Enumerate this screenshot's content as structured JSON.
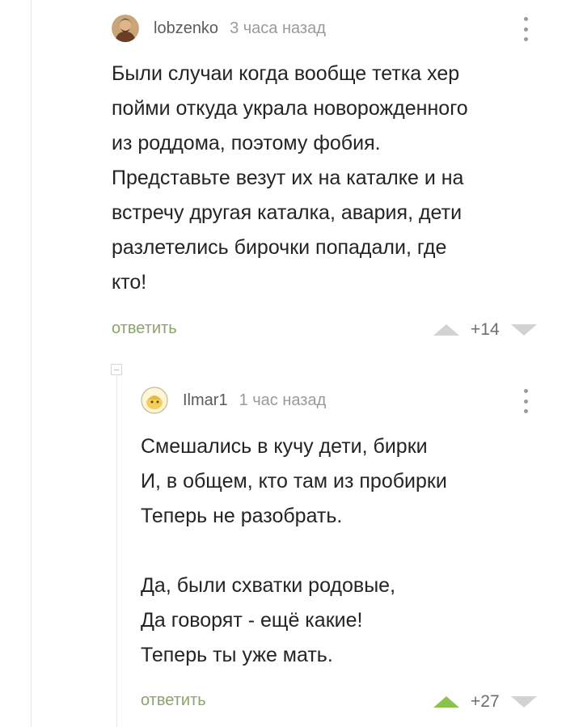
{
  "colors": {
    "reply_link": "#8aa46b",
    "upvote_active": "#8bc34a",
    "vote_inactive": "#d2d2d2",
    "thread_line": "#e6e6e6"
  },
  "comments": [
    {
      "author": "lobzenko",
      "time": "3 часа назад",
      "avatar_icon": "avatar-portrait-icon",
      "text": [
        "Были случаи когда вообще тетка хер",
        "пойми откуда украла новорожденного",
        "из роддома, поэтому фобия.",
        "Представьте везут их на каталке и на",
        "встречу другая каталка, авария, дети",
        "разлетелись бирочки попадали, где",
        "кто!"
      ],
      "reply_label": "ответить",
      "rating": "+14",
      "upvoted": false
    },
    {
      "author": "Ilmar1",
      "time": "1 час назад",
      "avatar_icon": "avatar-cartoon-icon",
      "text": [
        "Смешались в кучу дети, бирки",
        "И, в общем, кто там из пробирки",
        "Теперь не разобрать.",
        "",
        "Да, были схватки родовые,",
        "Да говорят - ещё какие!",
        "Теперь ты уже мать."
      ],
      "reply_label": "ответить",
      "rating": "+27",
      "upvoted": true
    }
  ]
}
